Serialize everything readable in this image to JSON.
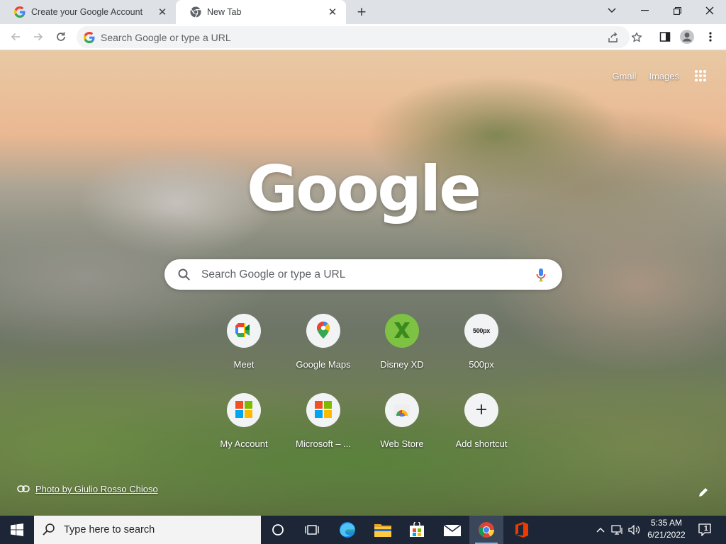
{
  "tabs": [
    {
      "title": "Create your Google Account",
      "favicon": "google-g-icon",
      "active": false
    },
    {
      "title": "New Tab",
      "favicon": "chrome-icon",
      "active": true
    }
  ],
  "toolbar": {
    "omnibox_placeholder": "Search Google or type a URL"
  },
  "ntp": {
    "gmail": "Gmail",
    "images": "Images",
    "logo": "Google",
    "search_placeholder": "Search Google or type a URL",
    "shortcuts": [
      {
        "label": "Meet",
        "icon": "meet-icon"
      },
      {
        "label": "Google Maps",
        "icon": "maps-pin-icon"
      },
      {
        "label": "Disney XD",
        "icon": "disney-xd-icon"
      },
      {
        "label": "500px",
        "icon": "500px-icon",
        "icon_text": "500px"
      },
      {
        "label": "My Account",
        "icon": "microsoft-logo-icon"
      },
      {
        "label": "Microsoft – ...",
        "icon": "microsoft-logo-icon"
      },
      {
        "label": "Web Store",
        "icon": "web-store-icon"
      },
      {
        "label": "Add shortcut",
        "icon": "plus-icon"
      }
    ],
    "attribution": "Photo by Giulio Rosso Chioso"
  },
  "taskbar": {
    "search_placeholder": "Type here to search",
    "time": "5:35 AM",
    "date": "6/21/2022",
    "notification_count": "1"
  },
  "colors": {
    "tab_strip": "#dee1e6",
    "taskbar": "#1c2636",
    "accent_blue": "#1a73e8"
  }
}
